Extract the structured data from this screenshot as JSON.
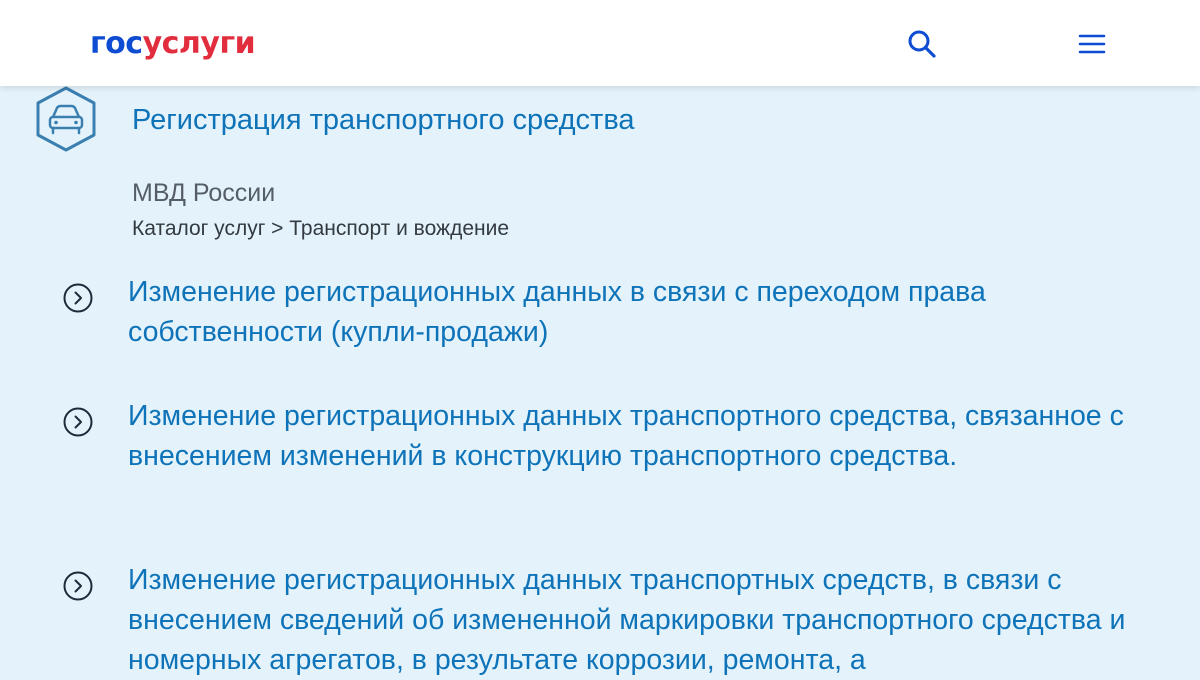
{
  "header": {
    "logo_part1": "гос",
    "logo_part2": "услуги",
    "search_icon": "search-icon",
    "menu_icon": "hamburger-menu-icon"
  },
  "service": {
    "icon": "car-icon",
    "title": "Регистрация транспортного средства",
    "agency": "МВД России",
    "breadcrumb": "Каталог услуг > Транспорт и вождение"
  },
  "items": [
    {
      "text": "Изменение регистрационных данных в связи с переходом права собственности (купли-продажи)"
    },
    {
      "text": "Изменение регистрационных данных транспортного средства, связанное с внесением изменений в конструкцию транспортного средства."
    },
    {
      "text": "Изменение регистрационных данных транспортных средств, в связи с внесением сведений об измененной маркировки транспортного средства и номерных агрегатов, в результате коррозии, ремонта, а"
    }
  ],
  "colors": {
    "brand_blue": "#0d4cd3",
    "brand_red": "#e12d3e",
    "link_blue": "#0e73b8",
    "background": "#e4f3fb"
  }
}
